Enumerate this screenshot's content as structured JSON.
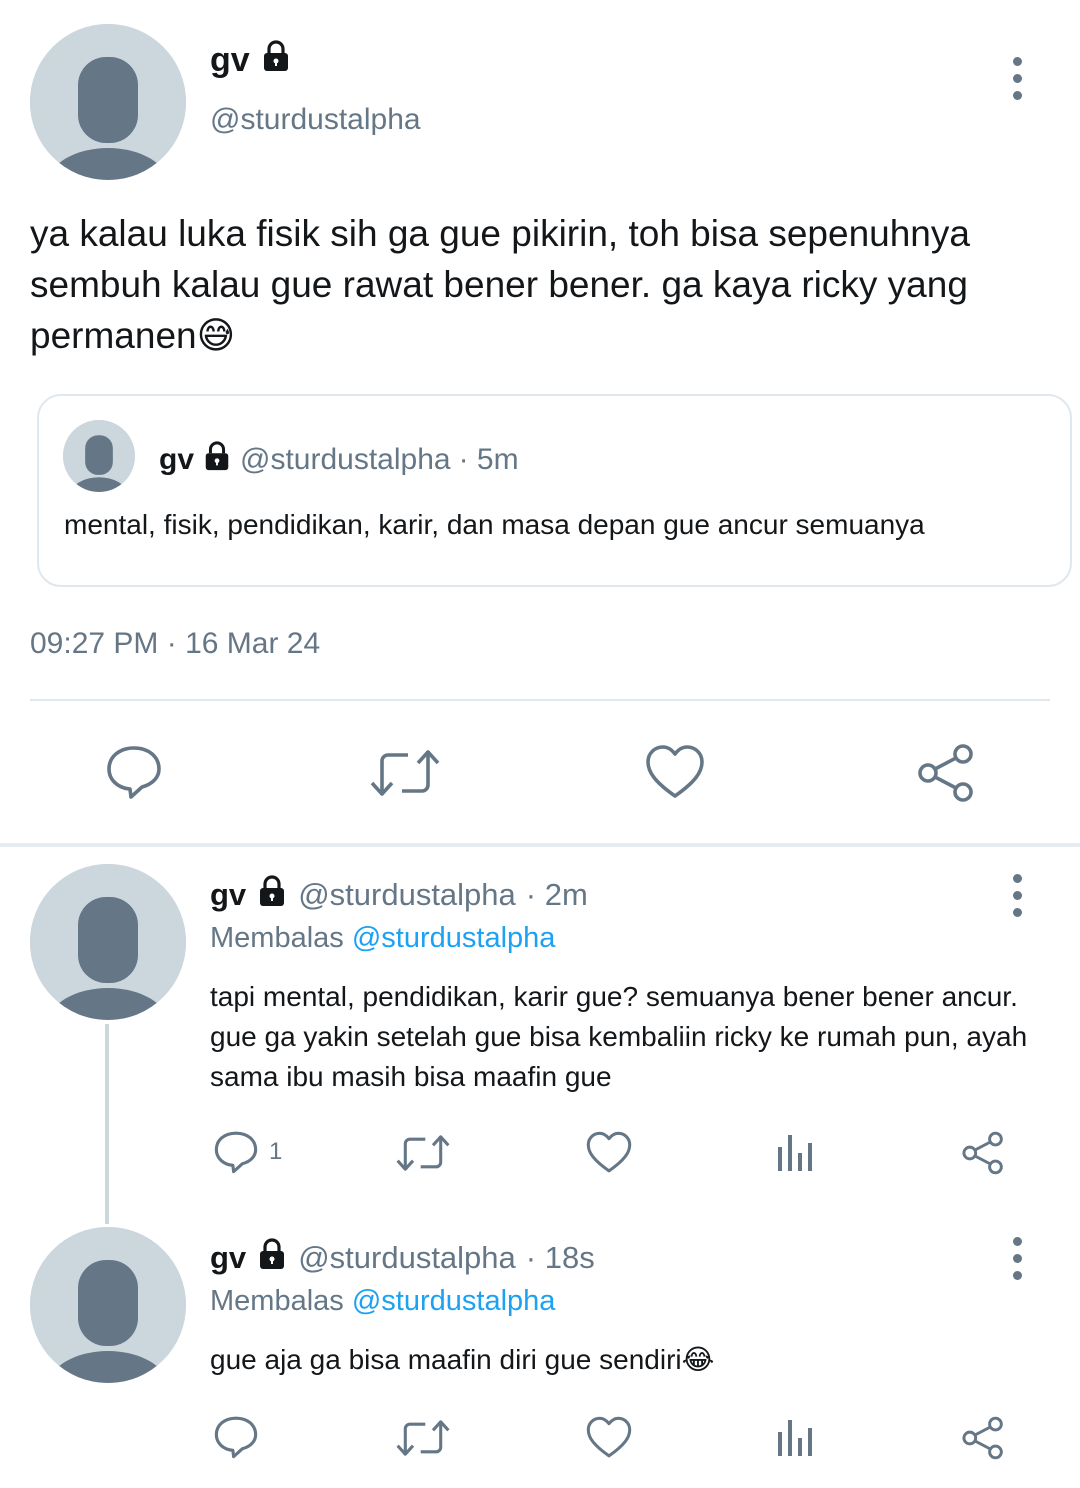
{
  "main_tweet": {
    "name": "gv",
    "handle": "@sturdustalpha",
    "text": "ya kalau luka fisik sih ga gue pikirin, toh bisa sepenuhnya sembuh kalau gue rawat bener bener. ga kaya ricky yang permanen",
    "emoji": "😅",
    "timestamp": "09:27 PM · 16 Mar 24",
    "quote": {
      "name": "gv",
      "handle": "@sturdustalpha",
      "age": "· 5m",
      "text": "mental, fisik, pendidikan, karir, dan masa depan gue ancur semuanya"
    }
  },
  "replies": [
    {
      "name": "gv",
      "handle": "@sturdustalpha",
      "age": "· 2m",
      "replying_label": "Membalas",
      "replying_to": "@sturdustalpha",
      "text": "tapi mental, pendidikan, karir gue? semuanya bener bener ancur. gue ga yakin setelah gue bisa kembaliin ricky ke rumah pun, ayah sama ibu masih bisa maafin gue",
      "emoji": "",
      "reply_count": "1"
    },
    {
      "name": "gv",
      "handle": "@sturdustalpha",
      "age": "· 18s",
      "replying_label": "Membalas",
      "replying_to": "@sturdustalpha",
      "text": "gue aja ga bisa maafin diri gue sendiri",
      "emoji": "😂",
      "reply_count": ""
    }
  ],
  "icons": {
    "lock": "lock-icon",
    "reply": "reply-icon",
    "retweet": "retweet-icon",
    "like": "heart-icon",
    "views": "views-icon",
    "share": "share-icon",
    "more": "more-options-icon"
  },
  "colors": {
    "text": "#14171a",
    "muted": "#657786",
    "link": "#1da1f2",
    "avatar_bg": "#ccd6dd",
    "avatar_fg": "#657786"
  }
}
